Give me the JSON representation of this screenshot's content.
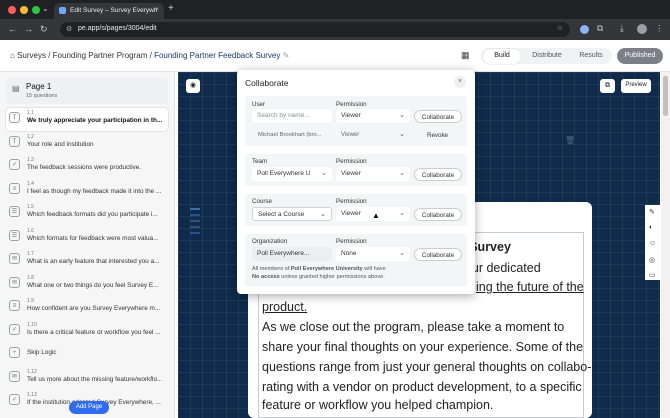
{
  "browser": {
    "tab_title": "Edit Survey – Survey Everywh",
    "url": "pe.app/s/pages/3004/edit",
    "colors": {
      "close": "#ff5f57",
      "minimize": "#febc2e",
      "maximize": "#28c840"
    }
  },
  "header": {
    "breadcrumb_root": "Surveys",
    "breadcrumb_program": "/ Founding Partner Program",
    "breadcrumb_survey": "/ Founding Partner Feedback Survey",
    "tabs": [
      "Build",
      "Distribute",
      "Results"
    ],
    "active_tab": "Build",
    "published_label": "Published"
  },
  "sidebar": {
    "page_title": "Page 1",
    "page_subtitle": "15 questions",
    "questions": [
      {
        "num": "1.1",
        "label": "We truly appreciate your participation in th...",
        "icon": "text-icon"
      },
      {
        "num": "1.2",
        "label": "Your role and institution",
        "icon": "text-icon"
      },
      {
        "num": "1.3",
        "label": "The feedback sessions were productive.",
        "icon": "check-icon"
      },
      {
        "num": "1.4",
        "label": "I feel as though my feedback made it into the ...",
        "icon": "scale-icon"
      },
      {
        "num": "1.5",
        "label": "Which feedback formats did you participate i...",
        "icon": "list-icon"
      },
      {
        "num": "1.6",
        "label": "Which formats for feedback were most valua...",
        "icon": "list-icon"
      },
      {
        "num": "1.7",
        "label": "What is an early feature that interested you a...",
        "icon": "chat-icon"
      },
      {
        "num": "1.8",
        "label": "What one or two things do you feel Survey E...",
        "icon": "chat-icon"
      },
      {
        "num": "1.9",
        "label": "How confident are you Survey Everywhere m...",
        "icon": "scale-icon"
      },
      {
        "num": "1.10",
        "label": "Is there a critical feature or workflow you feel ...",
        "icon": "check-icon"
      },
      {
        "num": "",
        "label": "Skip Logic",
        "icon": "branch-icon"
      },
      {
        "num": "1.12",
        "label": "Tell us more about the missing feature/workflo...",
        "icon": "chat-icon"
      },
      {
        "num": "1.13",
        "label": "If the institution adopted Survey Everywhere, ...",
        "icon": "check-icon"
      }
    ],
    "add_page_label": "Add Page"
  },
  "canvas": {
    "preview_label": "Preview",
    "body_lines": [
      "the Survey",
      ". Your dedicated",
      "ing the future of the",
      "product.",
      "As we close out the program, please take a moment to",
      "share your final thoughts on your experience. Some of the",
      "questions range from just your general thoughts on collabo-",
      "rating with a vendor on product development, to a specific",
      "feature or workflow you helped champion."
    ]
  },
  "modal": {
    "title": "Collaborate",
    "user": {
      "label": "User",
      "permission_label": "Permission",
      "placeholder": "Search by name...",
      "permission": "Viewer",
      "button": "Collaborate",
      "member_name": "Michael Brookhart (bro...",
      "member_permission": "Viewer",
      "revoke": "Revoke"
    },
    "team": {
      "label": "Team",
      "permission_label": "Permission",
      "value": "Poll Everywhere U",
      "permission": "Viewer",
      "button": "Collaborate"
    },
    "course": {
      "label": "Course",
      "permission_label": "Permission",
      "value": "Select a Course",
      "permission": "Viewer",
      "button": "Collaborate"
    },
    "organization": {
      "label": "Organization",
      "permission_label": "Permission",
      "value": "Poll Everywhere...",
      "permission": "None",
      "button": "Collaborate",
      "note_1": "All members of",
      "note_org": "Poll Everywhere University",
      "note_2": "will have",
      "note_3": "No access",
      "note_4": "unless granted higher permissions above."
    }
  }
}
